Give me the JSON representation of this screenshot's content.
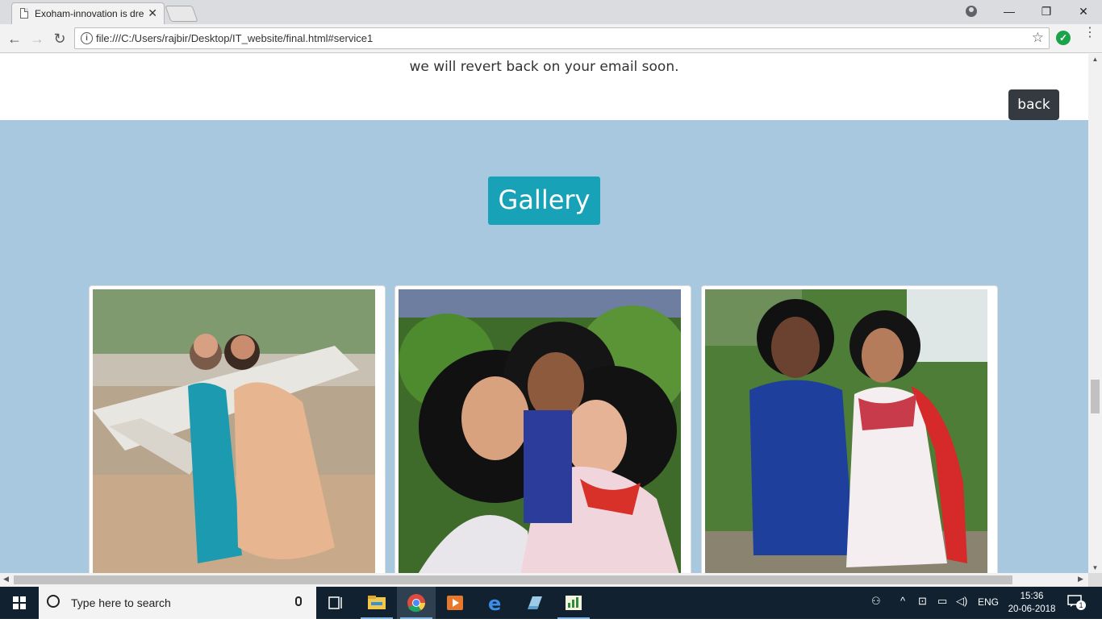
{
  "browser": {
    "tab_title": "Exoham-innovation is dre",
    "tab_close": "✕",
    "url": "file:///C:/Users/rajbir/Desktop/IT_website/final.html#service1",
    "window_controls": {
      "minimize": "—",
      "restore": "❐",
      "close": "✕"
    }
  },
  "page": {
    "revert_text": "we will revert back on your email soon.",
    "back_label": "back",
    "gallery_title": "Gallery",
    "gallery_bg": "#a8c8e0",
    "gallery_title_bg": "#17a2b8"
  },
  "taskbar": {
    "search_placeholder": "Type here to search",
    "language": "ENG",
    "time": "15:36",
    "date": "20-06-2018",
    "notification_count": "1"
  }
}
